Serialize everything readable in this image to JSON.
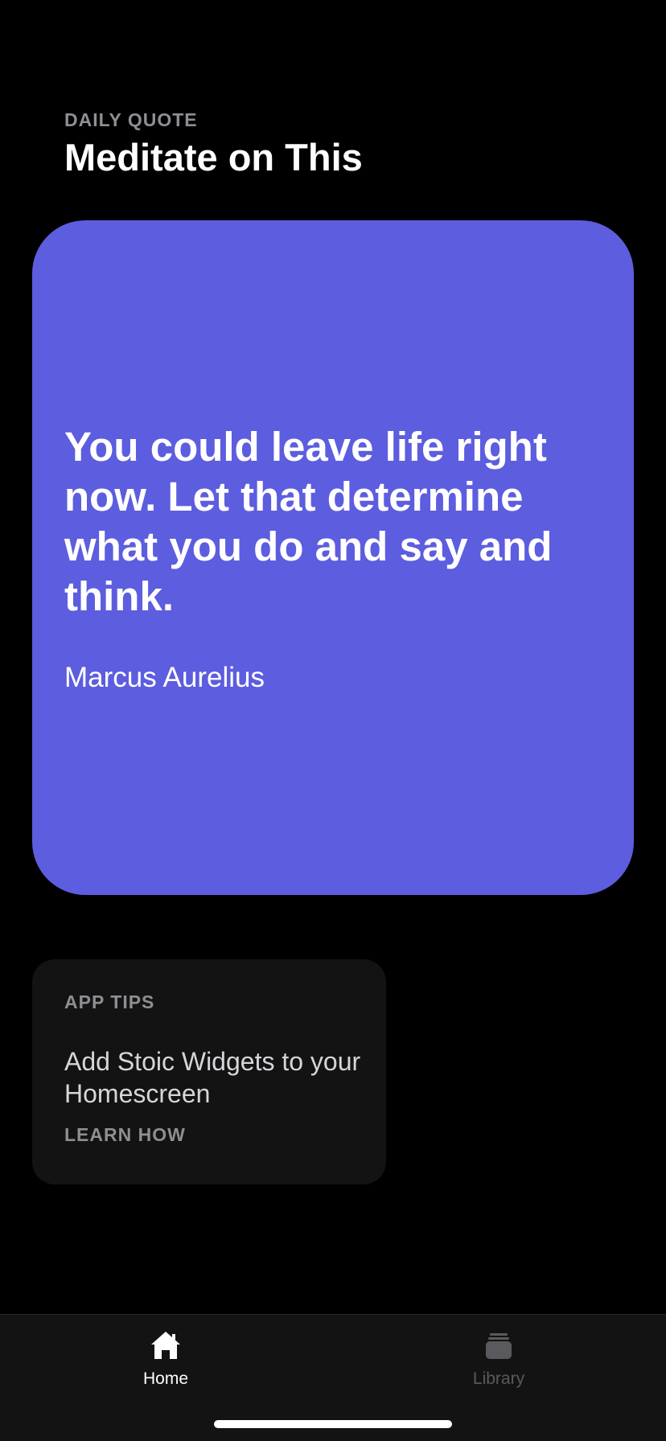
{
  "header": {
    "eyebrow": "DAILY QUOTE",
    "title": "Meditate on This"
  },
  "quote_card": {
    "text": "You could leave life right now. Let that determine what you do and say and think.",
    "author": "Marcus Aurelius",
    "background_color": "#5d5ddf"
  },
  "tips_card": {
    "eyebrow": "APP TIPS",
    "headline": "Add Stoic Widgets to your Homescreen",
    "link_label": "LEARN HOW"
  },
  "tab_bar": {
    "tabs": [
      {
        "label": "Home",
        "icon": "house-icon",
        "selected": true
      },
      {
        "label": "Library",
        "icon": "stack-icon",
        "selected": false
      }
    ]
  }
}
